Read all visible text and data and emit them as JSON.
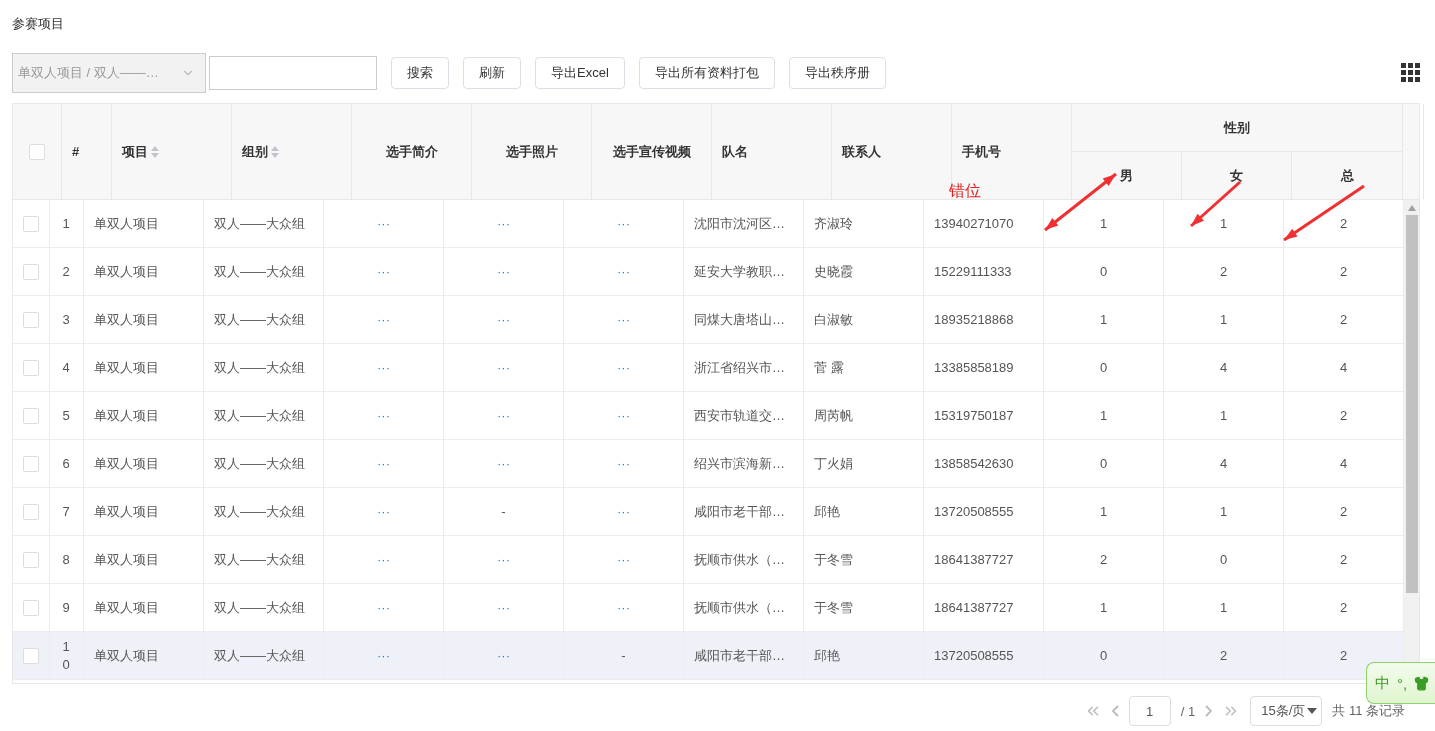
{
  "title": "参赛项目",
  "toolbar": {
    "select": "单双人项目 / 双人——…",
    "buttons": [
      "搜索",
      "刷新",
      "导出Excel",
      "导出所有资料打包",
      "导出秩序册"
    ]
  },
  "table": {
    "header_checked": false,
    "columns": [
      {
        "label": "#",
        "kind": "text",
        "sortable": false
      },
      {
        "label": "项目",
        "kind": "text",
        "sortable": true
      },
      {
        "label": "组别",
        "kind": "text",
        "sortable": true
      },
      {
        "label": "选手简介",
        "kind": "link",
        "sortable": false
      },
      {
        "label": "选手照片",
        "kind": "link",
        "sortable": false
      },
      {
        "label": "选手宣传视频",
        "kind": "link",
        "sortable": false
      },
      {
        "label": "队名",
        "kind": "text",
        "sortable": false
      },
      {
        "label": "联系人",
        "kind": "text",
        "sortable": false
      },
      {
        "label": "手机号",
        "kind": "text",
        "sortable": false
      }
    ],
    "group_header": {
      "label": "性别",
      "sub": [
        "男",
        "女",
        "总"
      ]
    },
    "rows": [
      {
        "checked": false,
        "highlighted": false,
        "cells": [
          "1",
          "单双人项目",
          "双人——大众组",
          "···",
          "···",
          "···",
          "沈阳市沈河区…",
          "齐淑玲",
          "13940271070",
          "1",
          "1",
          "2"
        ]
      },
      {
        "checked": false,
        "highlighted": false,
        "cells": [
          "2",
          "单双人项目",
          "双人——大众组",
          "···",
          "···",
          "···",
          "延安大学教职…",
          "史晓霞",
          "15229111333",
          "0",
          "2",
          "2"
        ]
      },
      {
        "checked": false,
        "highlighted": false,
        "cells": [
          "3",
          "单双人项目",
          "双人——大众组",
          "···",
          "···",
          "···",
          "同煤大唐塔山…",
          "白淑敏",
          "18935218868",
          "1",
          "1",
          "2"
        ]
      },
      {
        "checked": false,
        "highlighted": false,
        "cells": [
          "4",
          "单双人项目",
          "双人——大众组",
          "···",
          "···",
          "···",
          "浙江省绍兴市…",
          "菅 露",
          "13385858189",
          "0",
          "4",
          "4"
        ]
      },
      {
        "checked": false,
        "highlighted": false,
        "cells": [
          "5",
          "单双人项目",
          "双人——大众组",
          "···",
          "···",
          "···",
          "西安市轨道交…",
          "周芮帆",
          "15319750187",
          "1",
          "1",
          "2"
        ]
      },
      {
        "checked": false,
        "highlighted": false,
        "cells": [
          "6",
          "单双人项目",
          "双人——大众组",
          "···",
          "···",
          "···",
          "绍兴市滨海新…",
          "丁火娟",
          "13858542630",
          "0",
          "4",
          "4"
        ]
      },
      {
        "checked": false,
        "highlighted": false,
        "cells": [
          "7",
          "单双人项目",
          "双人——大众组",
          "···",
          "-",
          "···",
          "咸阳市老干部…",
          "邱艳",
          "13720508555",
          "1",
          "1",
          "2"
        ]
      },
      {
        "checked": false,
        "highlighted": false,
        "cells": [
          "8",
          "单双人项目",
          "双人——大众组",
          "···",
          "···",
          "···",
          "抚顺市供水（…",
          "于冬雪",
          "18641387727",
          "2",
          "0",
          "2"
        ]
      },
      {
        "checked": false,
        "highlighted": false,
        "cells": [
          "9",
          "单双人项目",
          "双人——大众组",
          "···",
          "···",
          "···",
          "抚顺市供水（…",
          "于冬雪",
          "18641387727",
          "1",
          "1",
          "2"
        ]
      },
      {
        "checked": false,
        "highlighted": true,
        "cells": [
          "10",
          "单双人项目",
          "双人——大众组",
          "···",
          "···",
          "-",
          "咸阳市老干部…",
          "邱艳",
          "13720508555",
          "0",
          "2",
          "2"
        ]
      }
    ]
  },
  "pagination": {
    "page": "1",
    "total_pages": "/ 1",
    "page_size": "15条/页",
    "records": "共 11 条记录"
  },
  "annotation": {
    "label": "错位"
  },
  "ime": {
    "mode": "中",
    "punct": "°,"
  }
}
